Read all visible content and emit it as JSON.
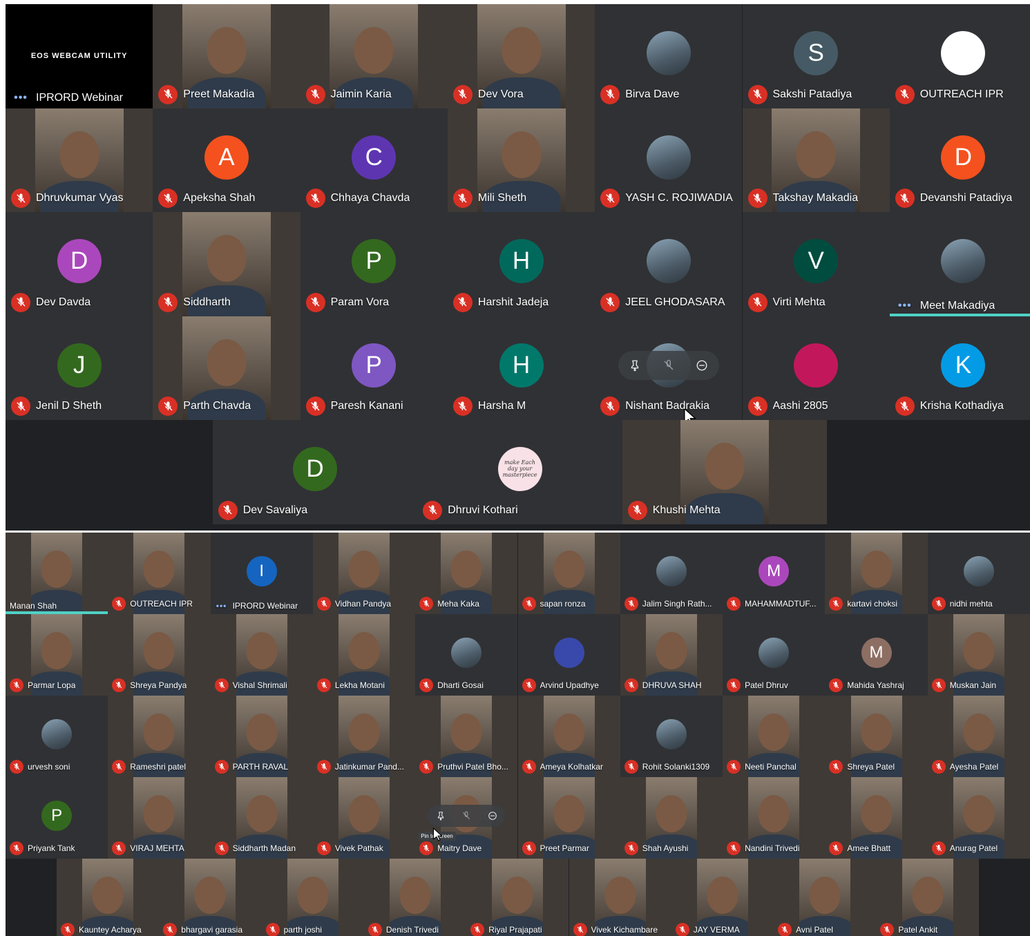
{
  "screen1": {
    "rows": [
      [
        {
          "name": "IPRORD Webinar",
          "type": "eos",
          "status": "dots",
          "eos_text": "EOS WEBCAM UTILITY"
        },
        {
          "name": "Preet Makadia",
          "type": "video",
          "status": "muted"
        },
        {
          "name": "Jaimin Karia",
          "type": "video",
          "status": "muted"
        },
        {
          "name": "Dev Vora",
          "type": "video",
          "status": "muted"
        },
        {
          "name": "Birva Dave",
          "type": "photo",
          "status": "muted"
        },
        {
          "name": "Sakshi Patadiya",
          "type": "letter",
          "letter": "S",
          "color": "#455a64",
          "status": "muted"
        },
        {
          "name": "OUTREACH IPR",
          "type": "photo",
          "status": "muted",
          "photo_color": "#ffffff"
        }
      ],
      [
        {
          "name": "Dhruvkumar Vyas",
          "type": "video",
          "status": "muted"
        },
        {
          "name": "Apeksha Shah",
          "type": "letter",
          "letter": "A",
          "color": "#f4511e",
          "status": "muted"
        },
        {
          "name": "Chhaya Chavda",
          "type": "letter",
          "letter": "C",
          "color": "#5e35b1",
          "status": "muted"
        },
        {
          "name": "Mili Sheth",
          "type": "video",
          "status": "muted"
        },
        {
          "name": "YASH C. ROJIWADIA",
          "type": "photo",
          "status": "muted"
        },
        {
          "name": "Takshay Makadia",
          "type": "video",
          "status": "muted"
        },
        {
          "name": "Devanshi Patadiya",
          "type": "letter",
          "letter": "D",
          "color": "#f4511e",
          "status": "muted"
        }
      ],
      [
        {
          "name": "Dev Davda",
          "type": "letter",
          "letter": "D",
          "color": "#ab47bc",
          "status": "muted"
        },
        {
          "name": "Siddharth",
          "type": "video",
          "status": "muted"
        },
        {
          "name": "Param Vora",
          "type": "letter",
          "letter": "P",
          "color": "#33691e",
          "status": "muted"
        },
        {
          "name": "Harshit Jadeja",
          "type": "letter",
          "letter": "H",
          "color": "#00695c",
          "status": "muted"
        },
        {
          "name": "JEEL GHODASARA",
          "type": "photo",
          "status": "muted"
        },
        {
          "name": "Virti Mehta",
          "type": "letter",
          "letter": "V",
          "color": "#004d40",
          "status": "muted"
        },
        {
          "name": "Meet Makadiya",
          "type": "photo",
          "status": "dots",
          "speaking": true
        }
      ],
      [
        {
          "name": "Jenil D Sheth",
          "type": "letter",
          "letter": "J",
          "color": "#33691e",
          "status": "muted"
        },
        {
          "name": "Parth Chavda",
          "type": "video",
          "status": "muted"
        },
        {
          "name": "Paresh Kanani",
          "type": "letter",
          "letter": "P",
          "color": "#7e57c2",
          "status": "muted"
        },
        {
          "name": "Harsha M",
          "type": "letter",
          "letter": "H",
          "color": "#00796b",
          "status": "muted"
        },
        {
          "name": "Nishant Badrakia",
          "type": "photo",
          "status": "muted",
          "hover": true
        },
        {
          "name": "Aashi 2805",
          "type": "photo",
          "status": "muted",
          "photo_color": "#c2185b"
        },
        {
          "name": "Krisha Kothadiya",
          "type": "letter",
          "letter": "K",
          "color": "#039be5",
          "status": "muted"
        }
      ],
      [
        {
          "name": "Dev Savaliya",
          "type": "letter",
          "letter": "D",
          "color": "#33691e",
          "status": "muted"
        },
        {
          "name": "Dhruvi Kothari",
          "type": "photo",
          "status": "muted",
          "photo_color": "#f8e1e7",
          "photo_text": "make Each day your masterpiece"
        },
        {
          "name": "Khushi Mehta",
          "type": "video",
          "status": "muted"
        }
      ]
    ]
  },
  "screen2": {
    "rows": [
      [
        {
          "name": "Manan Shah",
          "type": "video",
          "status": "none",
          "speaking": true
        },
        {
          "name": "OUTREACH IPR",
          "type": "video",
          "status": "muted"
        },
        {
          "name": "IPRORD Webinar",
          "type": "letter",
          "letter": "I",
          "color": "#1565c0",
          "status": "dots"
        },
        {
          "name": "Vidhan Pandya",
          "type": "video",
          "status": "muted"
        },
        {
          "name": "Meha Kaka",
          "type": "video",
          "status": "muted"
        },
        {
          "name": "sapan ronza",
          "type": "video",
          "status": "muted"
        },
        {
          "name": "Jalim Singh Rath...",
          "type": "photo",
          "status": "muted"
        },
        {
          "name": "MAHAMMADTUF...",
          "type": "letter",
          "letter": "M",
          "color": "#ab47bc",
          "status": "muted"
        },
        {
          "name": "kartavi choksi",
          "type": "video",
          "status": "muted"
        },
        {
          "name": "nidhi mehta",
          "type": "photo",
          "status": "muted"
        }
      ],
      [
        {
          "name": "Parmar Lopa",
          "type": "video",
          "status": "muted"
        },
        {
          "name": "Shreya Pandya",
          "type": "video",
          "status": "muted"
        },
        {
          "name": "Vishal Shrimali",
          "type": "video",
          "status": "muted"
        },
        {
          "name": "Lekha Motani",
          "type": "video",
          "status": "muted"
        },
        {
          "name": "Dharti Gosai",
          "type": "photo",
          "status": "muted"
        },
        {
          "name": "Arvind Upadhye",
          "type": "photo",
          "status": "muted",
          "photo_color": "#3949ab"
        },
        {
          "name": "DHRUVA SHAH",
          "type": "video",
          "status": "muted"
        },
        {
          "name": "Patel Dhruv",
          "type": "photo",
          "status": "muted"
        },
        {
          "name": "Mahida Yashraj",
          "type": "letter",
          "letter": "M",
          "color": "#8d6e63",
          "status": "muted"
        },
        {
          "name": "Muskan Jain",
          "type": "video",
          "status": "muted"
        }
      ],
      [
        {
          "name": "urvesh soni",
          "type": "photo",
          "status": "muted"
        },
        {
          "name": "Rameshri patel",
          "type": "video",
          "status": "muted"
        },
        {
          "name": "PARTH RAVAL",
          "type": "video",
          "status": "muted"
        },
        {
          "name": "Jatinkumar Pand...",
          "type": "video",
          "status": "muted"
        },
        {
          "name": "Pruthvi Patel Bho...",
          "type": "video",
          "status": "muted"
        },
        {
          "name": "Ameya Kolhatkar",
          "type": "video",
          "status": "muted"
        },
        {
          "name": "Rohit Solanki1309",
          "type": "photo",
          "status": "muted"
        },
        {
          "name": "Neeti Panchal",
          "type": "video",
          "status": "muted"
        },
        {
          "name": "Shreya Patel",
          "type": "video",
          "status": "muted"
        },
        {
          "name": "Ayesha Patel",
          "type": "video",
          "status": "muted"
        }
      ],
      [
        {
          "name": "Priyank Tank",
          "type": "letter",
          "letter": "P",
          "color": "#33691e",
          "status": "muted"
        },
        {
          "name": "VIRAJ MEHTA",
          "type": "video",
          "status": "muted"
        },
        {
          "name": "Siddharth Madan",
          "type": "video",
          "status": "muted"
        },
        {
          "name": "Vivek Pathak",
          "type": "video",
          "status": "muted"
        },
        {
          "name": "Maitry Dave",
          "type": "video",
          "status": "muted",
          "hover": true,
          "tooltip": "Pin to screen"
        },
        {
          "name": "Preet Parmar",
          "type": "video",
          "status": "muted"
        },
        {
          "name": "Shah Ayushi",
          "type": "video",
          "status": "muted"
        },
        {
          "name": "Nandini Trivedi",
          "type": "video",
          "status": "muted"
        },
        {
          "name": "Amee Bhatt",
          "type": "video",
          "status": "muted"
        },
        {
          "name": "Anurag Patel",
          "type": "video",
          "status": "muted"
        }
      ],
      [
        {
          "name": "Kauntey Acharya",
          "type": "video",
          "status": "muted"
        },
        {
          "name": "bhargavi garasia",
          "type": "video",
          "status": "muted"
        },
        {
          "name": "parth joshi",
          "type": "video",
          "status": "muted"
        },
        {
          "name": "Denish Trivedi",
          "type": "video",
          "status": "muted"
        },
        {
          "name": "Riyal Prajapati",
          "type": "video",
          "status": "muted"
        },
        {
          "name": "Vivek Kichambare",
          "type": "video",
          "status": "muted"
        },
        {
          "name": "JAY VERMA",
          "type": "video",
          "status": "muted"
        },
        {
          "name": "Avni Patel",
          "type": "video",
          "status": "muted"
        },
        {
          "name": "Patel Ankit",
          "type": "video",
          "status": "muted"
        }
      ]
    ]
  },
  "colors": {
    "background": "#202124",
    "tile": "#3c4043",
    "muted": "#d93025",
    "speaking": "#4fd1c5",
    "dots": "#8ab4f8"
  },
  "icons": [
    "mic-off-icon",
    "more-dots-icon",
    "pin-icon",
    "mute-icon",
    "remove-icon",
    "cursor-icon"
  ]
}
